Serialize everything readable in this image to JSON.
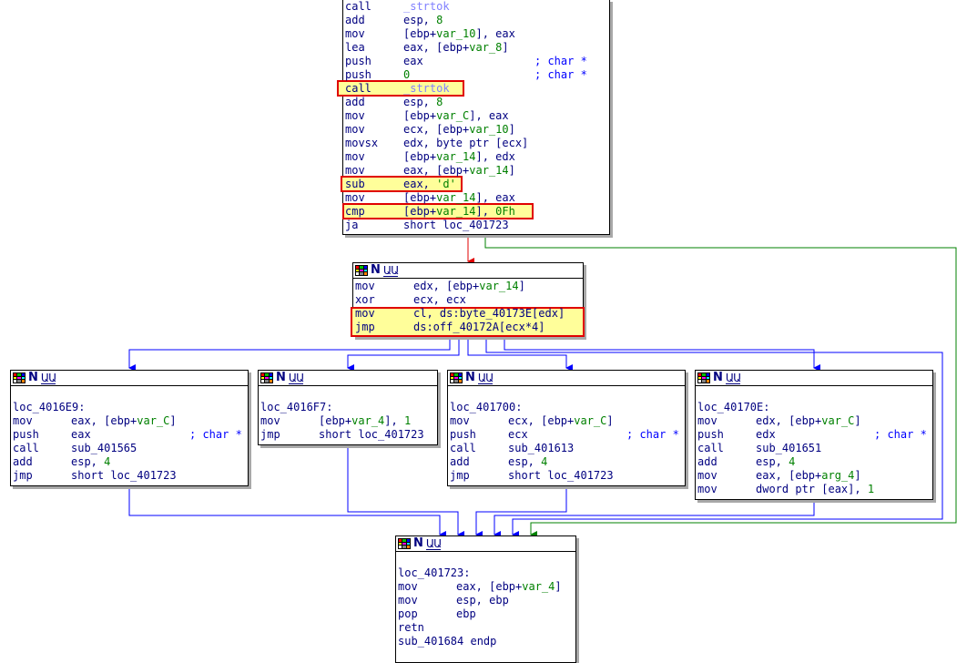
{
  "colors": {
    "text": "#000080",
    "comment": "#0000ff",
    "variable": "#008000",
    "function": "#8080ff",
    "highlight_border": "#e00000",
    "highlight_fill": "#fffe9a",
    "edge_blue": "#0000ff",
    "edge_red": "#e00000",
    "edge_green": "#008000"
  },
  "header_icons": [
    "graph-grid-icon",
    "node-n-icon",
    "node-u-icon"
  ],
  "node_top": {
    "lines": [
      {
        "m": "call",
        "o": "_strtok"
      },
      {
        "m": "add",
        "o": "esp, 8"
      },
      {
        "m": "mov",
        "o": "[ebp+var_10], eax"
      },
      {
        "m": "lea",
        "o": "eax, [ebp+var_8]"
      },
      {
        "m": "push",
        "o": "eax",
        "c": "; char *"
      },
      {
        "m": "push",
        "o": "0",
        "c": "; char *"
      },
      {
        "m": "call",
        "o": "_strtok"
      },
      {
        "m": "add",
        "o": "esp, 8"
      },
      {
        "m": "mov",
        "o": "[ebp+var_C], eax"
      },
      {
        "m": "mov",
        "o": "ecx, [ebp+var_10]"
      },
      {
        "m": "movsx",
        "o": "edx, byte ptr [ecx]"
      },
      {
        "m": "mov",
        "o": "[ebp+var_14], edx"
      },
      {
        "m": "mov",
        "o": "eax, [ebp+var_14]"
      },
      {
        "m": "sub",
        "o": "eax, 'd'"
      },
      {
        "m": "mov",
        "o": "[ebp+var_14], eax"
      },
      {
        "m": "cmp",
        "o": "[ebp+var_14], 0Fh"
      },
      {
        "m": "ja",
        "o": "short loc_401723"
      }
    ]
  },
  "node_switch": {
    "lines": [
      {
        "m": "mov",
        "o": "edx, [ebp+var_14]"
      },
      {
        "m": "xor",
        "o": "ecx, ecx"
      },
      {
        "m": "mov",
        "o": "cl, ds:byte_40173E[edx]"
      },
      {
        "m": "jmp",
        "o": "ds:off_40172A[ecx*4]"
      }
    ]
  },
  "node_case_a": {
    "label": "loc_4016E9:",
    "lines": [
      {
        "m": "mov",
        "o": "eax, [ebp+var_C]"
      },
      {
        "m": "push",
        "o": "eax",
        "c": "; char *"
      },
      {
        "m": "call",
        "o": "sub_401565"
      },
      {
        "m": "add",
        "o": "esp, 4"
      },
      {
        "m": "jmp",
        "o": "short loc_401723"
      }
    ]
  },
  "node_case_b": {
    "label": "loc_4016F7:",
    "lines": [
      {
        "m": "mov",
        "o": "[ebp+var_4], 1"
      },
      {
        "m": "jmp",
        "o": "short loc_401723"
      }
    ]
  },
  "node_case_c": {
    "label": "loc_401700:",
    "lines": [
      {
        "m": "mov",
        "o": "ecx, [ebp+var_C]"
      },
      {
        "m": "push",
        "o": "ecx",
        "c": "; char *"
      },
      {
        "m": "call",
        "o": "sub_401613"
      },
      {
        "m": "add",
        "o": "esp, 4"
      },
      {
        "m": "jmp",
        "o": "short loc_401723"
      }
    ]
  },
  "node_case_d": {
    "label": "loc_40170E:",
    "lines": [
      {
        "m": "mov",
        "o": "edx, [ebp+var_C]"
      },
      {
        "m": "push",
        "o": "edx",
        "c": "; char *"
      },
      {
        "m": "call",
        "o": "sub_401651"
      },
      {
        "m": "add",
        "o": "esp, 4"
      },
      {
        "m": "mov",
        "o": "eax, [ebp+arg_4]"
      },
      {
        "m": "mov",
        "o": "dword ptr [eax], 1"
      }
    ]
  },
  "node_end": {
    "label": "loc_401723:",
    "lines": [
      {
        "m": "mov",
        "o": "eax, [ebp+var_4]"
      },
      {
        "m": "mov",
        "o": "esp, ebp"
      },
      {
        "m": "pop",
        "o": "ebp"
      },
      {
        "m": "retn",
        "o": ""
      },
      {
        "m": "sub_401684 endp",
        "o": ""
      }
    ]
  }
}
